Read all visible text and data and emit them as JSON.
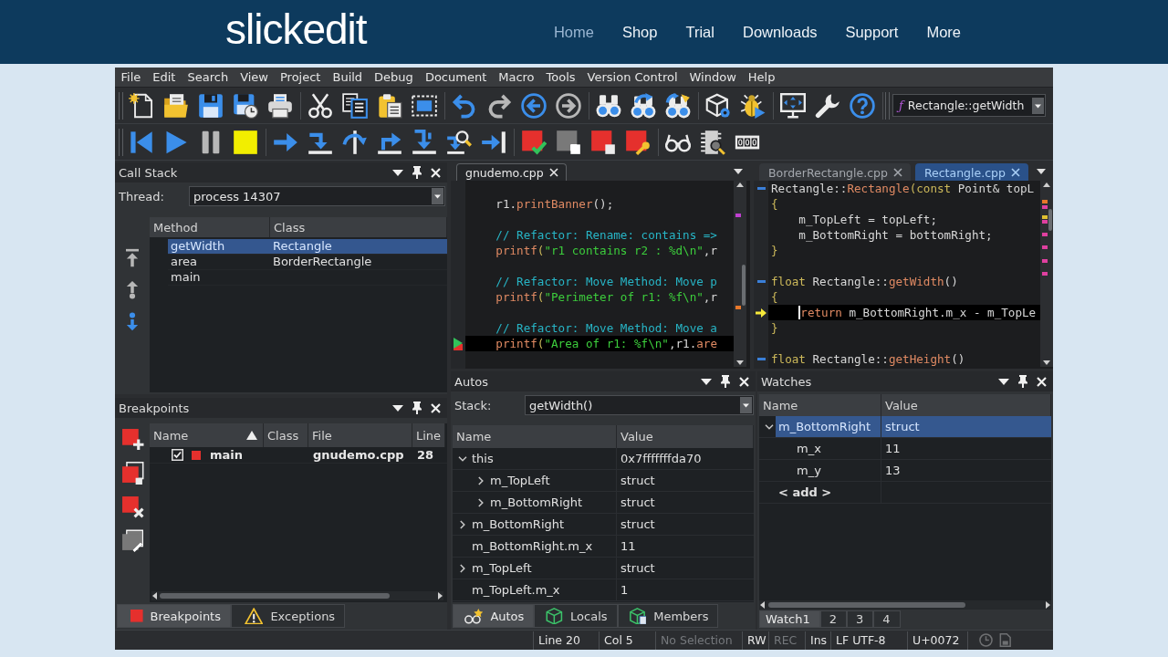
{
  "site_header": {
    "logo": "slickedit",
    "nav": [
      {
        "label": "Home",
        "selected": true
      },
      {
        "label": "Shop",
        "selected": false
      },
      {
        "label": "Trial",
        "selected": false
      },
      {
        "label": "Downloads",
        "selected": false
      },
      {
        "label": "Support",
        "selected": false
      },
      {
        "label": "More",
        "selected": false
      }
    ]
  },
  "menu_bar": [
    "File",
    "Edit",
    "Search",
    "View",
    "Project",
    "Build",
    "Debug",
    "Document",
    "Macro",
    "Tools",
    "Version Control",
    "Window",
    "Help"
  ],
  "toolbar_1": {
    "groups": [
      {
        "buttons": [
          {
            "kind": "new-file",
            "disabled": false
          },
          {
            "kind": "open-folder",
            "disabled": false
          },
          {
            "kind": "save",
            "disabled": false
          },
          {
            "kind": "save-clock",
            "disabled": false
          },
          {
            "kind": "print",
            "disabled": false
          }
        ]
      },
      {
        "buttons": [
          {
            "kind": "cut",
            "disabled": false
          },
          {
            "kind": "copy",
            "disabled": false
          },
          {
            "kind": "paste",
            "disabled": false
          },
          {
            "kind": "select-frame",
            "disabled": false
          }
        ]
      },
      {
        "buttons": [
          {
            "kind": "undo",
            "disabled": false
          },
          {
            "kind": "redo",
            "disabled": true
          },
          {
            "kind": "back",
            "disabled": false
          },
          {
            "kind": "forward",
            "disabled": true
          }
        ]
      },
      {
        "buttons": [
          {
            "kind": "find",
            "disabled": false
          },
          {
            "kind": "find-next",
            "disabled": false
          },
          {
            "kind": "find-replace",
            "disabled": false
          }
        ]
      },
      {
        "buttons": [
          {
            "kind": "box-gear",
            "disabled": false
          },
          {
            "kind": "bug",
            "disabled": false
          }
        ]
      },
      {
        "buttons": [
          {
            "kind": "monitor",
            "disabled": false
          },
          {
            "kind": "wrench",
            "disabled": false
          },
          {
            "kind": "help",
            "disabled": false
          }
        ]
      }
    ],
    "combo": {
      "icon": "ƒ",
      "value": "Rectangle::getWidth"
    }
  },
  "toolbar_2": {
    "groups": [
      {
        "buttons": [
          {
            "kind": "restart",
            "disabled": false
          },
          {
            "kind": "play",
            "disabled": false
          },
          {
            "kind": "pause",
            "disabled": true
          },
          {
            "kind": "stop",
            "disabled": false
          }
        ]
      },
      {
        "buttons": [
          {
            "kind": "show-next",
            "disabled": false
          },
          {
            "kind": "step-into",
            "disabled": false
          },
          {
            "kind": "step-over",
            "disabled": false
          },
          {
            "kind": "step-out",
            "disabled": false
          },
          {
            "kind": "step-deep",
            "disabled": false
          },
          {
            "kind": "step-search",
            "disabled": false
          },
          {
            "kind": "run-to-cursor",
            "disabled": false
          }
        ]
      },
      {
        "buttons": [
          {
            "kind": "bp-check",
            "disabled": false
          },
          {
            "kind": "bp-square",
            "disabled": true
          },
          {
            "kind": "bp-square",
            "disabled": false
          },
          {
            "kind": "bp-wrench",
            "disabled": false
          }
        ]
      },
      {
        "buttons": [
          {
            "kind": "glasses",
            "disabled": false
          },
          {
            "kind": "chip-search",
            "disabled": false
          },
          {
            "kind": "counter",
            "disabled": false
          }
        ]
      }
    ]
  },
  "call_stack": {
    "title": "Call Stack",
    "thread_label": "Thread:",
    "thread": "process 14307",
    "nav_buttons": [
      {
        "kind": "stack-top",
        "disabled": true
      },
      {
        "kind": "stack-up",
        "disabled": true
      },
      {
        "kind": "stack-down",
        "disabled": false
      }
    ],
    "columns": [
      "Method",
      "Class"
    ],
    "rows": [
      {
        "method": "getWidth",
        "class": "Rectangle",
        "selected": true
      },
      {
        "method": "area",
        "class": "BorderRectangle",
        "selected": false
      },
      {
        "method": "main",
        "selected": false
      }
    ]
  },
  "breakpoints": {
    "title": "Breakpoints",
    "tool_buttons": [
      {
        "kind": "bp-add",
        "disabled": false
      },
      {
        "kind": "bp-copy",
        "disabled": false
      },
      {
        "kind": "bp-delete",
        "disabled": false
      },
      {
        "kind": "bp-settings",
        "disabled": true
      }
    ],
    "columns": [
      {
        "label": "Name",
        "sorted": true
      },
      {
        "label": "Class",
        "sorted": false
      },
      {
        "label": "File",
        "sorted": false
      },
      {
        "label": "Line",
        "sorted": false
      }
    ],
    "rows": [
      {
        "checked": true,
        "name": "main",
        "file": "gnudemo.cpp",
        "line": "28"
      }
    ],
    "tabs": [
      {
        "label": "Breakpoints",
        "kind": "breakpoint",
        "selected": true
      },
      {
        "label": "Exceptions",
        "kind": "warning",
        "selected": false
      }
    ]
  },
  "editors": [
    {
      "focused": false,
      "tabs": [
        {
          "label": "gnudemo.cpp",
          "selected": true
        }
      ],
      "lines": [
        {
          "kind": "blank"
        },
        {
          "kind": "code",
          "indented": true,
          "current": false,
          "tokens": [
            {
              "kind": "plain",
              "text": "r1."
            },
            {
              "kind": "function",
              "text": "printBanner"
            },
            {
              "kind": "plain",
              "text": "();"
            }
          ]
        },
        {
          "kind": "blank"
        },
        {
          "kind": "code",
          "indented": true,
          "current": false,
          "tokens": [
            {
              "kind": "comment",
              "text": "// Refactor: Rename: contains =>"
            }
          ]
        },
        {
          "kind": "code",
          "indented": true,
          "current": false,
          "tokens": [
            {
              "kind": "function",
              "text": "printf"
            },
            {
              "kind": "brace",
              "text": "("
            },
            {
              "kind": "string",
              "text": "\"r1 contains r2 : %d\\n\""
            },
            {
              "kind": "plain",
              "text": ",r"
            }
          ]
        },
        {
          "kind": "blank"
        },
        {
          "kind": "code",
          "indented": true,
          "current": false,
          "tokens": [
            {
              "kind": "comment",
              "text": "// Refactor: Move Method: Move p"
            }
          ]
        },
        {
          "kind": "code",
          "indented": true,
          "current": false,
          "tokens": [
            {
              "kind": "function",
              "text": "printf"
            },
            {
              "kind": "brace",
              "text": "("
            },
            {
              "kind": "string",
              "text": "\"Perimeter of r1: %f\\n\""
            },
            {
              "kind": "plain",
              "text": ",r"
            }
          ]
        },
        {
          "kind": "blank"
        },
        {
          "kind": "code",
          "indented": true,
          "current": false,
          "tokens": [
            {
              "kind": "comment",
              "text": "// Refactor: Move Method: Move a"
            }
          ]
        },
        {
          "kind": "breakpoint",
          "indented": true,
          "current": true,
          "tokens": [
            {
              "kind": "function",
              "text": "printf"
            },
            {
              "kind": "brace",
              "text": "("
            },
            {
              "kind": "string",
              "text": "\"Area of r1: %f\\n\""
            },
            {
              "kind": "plain",
              "text": ",r1."
            },
            {
              "kind": "function",
              "text": "are"
            }
          ]
        },
        {
          "kind": "blank"
        }
      ]
    },
    {
      "focused": true,
      "tabs": [
        {
          "label": "BorderRectangle.cpp",
          "selected": false
        },
        {
          "label": "Rectangle.cpp",
          "selected": true
        }
      ],
      "lines": [
        {
          "kind": "function-start",
          "indented": false,
          "current": false,
          "tokens": [
            {
              "kind": "plain",
              "text": "Rectangle::"
            },
            {
              "kind": "function",
              "text": "Rectangle"
            },
            {
              "kind": "brace",
              "text": "("
            },
            {
              "kind": "type",
              "text": "const"
            },
            {
              "kind": "plain",
              "text": " Point& topL"
            }
          ]
        },
        {
          "kind": "code",
          "indented": false,
          "current": false,
          "tokens": [
            {
              "kind": "brace",
              "text": "{"
            }
          ]
        },
        {
          "kind": "code",
          "indented": true,
          "current": false,
          "tokens": [
            {
              "kind": "plain",
              "text": "m_TopLeft = topLeft;"
            }
          ]
        },
        {
          "kind": "code",
          "indented": true,
          "current": false,
          "tokens": [
            {
              "kind": "plain",
              "text": "m_BottomRight = bottomRight;"
            }
          ]
        },
        {
          "kind": "code",
          "indented": false,
          "current": false,
          "tokens": [
            {
              "kind": "brace",
              "text": "}"
            }
          ]
        },
        {
          "kind": "blank"
        },
        {
          "kind": "function-start",
          "indented": false,
          "current": false,
          "tokens": [
            {
              "kind": "type",
              "text": "float"
            },
            {
              "kind": "plain",
              "text": " Rectangle::"
            },
            {
              "kind": "function",
              "text": "getWidth"
            },
            {
              "kind": "plain",
              "text": "()"
            }
          ]
        },
        {
          "kind": "code",
          "indented": false,
          "current": false,
          "tokens": [
            {
              "kind": "brace",
              "text": "{"
            }
          ]
        },
        {
          "kind": "execution",
          "indented": true,
          "current": true,
          "tokens": [
            {
              "kind": "keyword",
              "text": "return"
            },
            {
              "kind": "plain",
              "text": " m_BottomRight.m_x - m_TopLe"
            }
          ]
        },
        {
          "kind": "code",
          "indented": false,
          "current": false,
          "tokens": [
            {
              "kind": "brace",
              "text": "}"
            }
          ]
        },
        {
          "kind": "blank"
        },
        {
          "kind": "function-start",
          "indented": false,
          "current": false,
          "tokens": [
            {
              "kind": "type",
              "text": "float"
            },
            {
              "kind": "plain",
              "text": " Rectangle::"
            },
            {
              "kind": "function",
              "text": "getHeight"
            },
            {
              "kind": "plain",
              "text": "()"
            }
          ]
        }
      ]
    }
  ],
  "autos": {
    "title": "Autos",
    "stack_label": "Stack:",
    "stack": "getWidth()",
    "columns": [
      "Name",
      "Value"
    ],
    "rows": [
      {
        "name": "this",
        "value": "0x7fffffffda70",
        "has_children": true,
        "expanded": true,
        "selected": false,
        "children": [
          {
            "name": "m_TopLeft",
            "value": "struct",
            "has_children": true,
            "expanded": false,
            "selected": false
          },
          {
            "name": "m_BottomRight",
            "value": "struct",
            "has_children": true,
            "expanded": false,
            "selected": false
          }
        ]
      },
      {
        "name": "m_BottomRight",
        "value": "struct",
        "has_children": true,
        "expanded": false,
        "selected": false
      },
      {
        "name": "m_BottomRight.m_x",
        "value": "11",
        "has_children": false,
        "selected": false
      },
      {
        "name": "m_TopLeft",
        "value": "struct",
        "has_children": true,
        "expanded": false,
        "selected": false
      },
      {
        "name": "m_TopLeft.m_x",
        "value": "1",
        "has_children": false,
        "selected": false
      }
    ],
    "tabs": [
      {
        "label": "Autos",
        "kind": "autos",
        "selected": true
      },
      {
        "label": "Locals",
        "kind": "locals",
        "selected": false
      },
      {
        "label": "Members",
        "kind": "members",
        "selected": false
      }
    ]
  },
  "watches": {
    "title": "Watches",
    "columns": [
      "Name",
      "Value"
    ],
    "rows": [
      {
        "kind": "watch",
        "name": "m_BottomRight",
        "value": "struct",
        "has_children": true,
        "expanded": true,
        "selected": true,
        "children": [
          {
            "kind": "watch",
            "name": "m_x",
            "value": "11",
            "has_children": false,
            "selected": false
          },
          {
            "kind": "watch",
            "name": "m_y",
            "value": "13",
            "has_children": false,
            "selected": false
          }
        ]
      },
      {
        "kind": "placeholder",
        "name": "< add >",
        "has_children": false,
        "selected": false
      }
    ],
    "tabs": [
      {
        "label": "Watch1",
        "selected": true
      },
      {
        "label": "2",
        "selected": false
      },
      {
        "label": "3",
        "selected": false
      },
      {
        "label": "4",
        "selected": false
      }
    ]
  },
  "status_bar": {
    "fields": [
      {
        "text": "Line 20",
        "disabled": false
      },
      {
        "text": "Col 5",
        "disabled": false
      },
      {
        "text": "No Selection",
        "disabled": true
      },
      {
        "text": "RW",
        "disabled": false
      },
      {
        "text": "REC",
        "disabled": true
      },
      {
        "text": "Ins",
        "disabled": false
      },
      {
        "text": "LF UTF-8",
        "disabled": false
      },
      {
        "text": "U+0072",
        "disabled": false
      }
    ],
    "indicators": [
      {
        "kind": "clock",
        "disabled": true
      },
      {
        "kind": "file",
        "disabled": true
      }
    ]
  }
}
